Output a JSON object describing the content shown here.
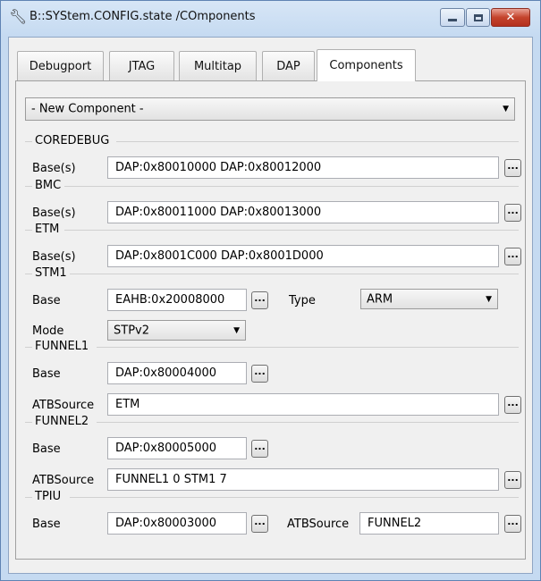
{
  "window": {
    "title": "B::SYStem.CONFIG.state /COmponents",
    "close_label": "✕",
    "app_icon": "wrench-icon"
  },
  "tabs": [
    {
      "label": "Debugport",
      "active": false
    },
    {
      "label": "JTAG",
      "active": false
    },
    {
      "label": "Multitap",
      "active": false
    },
    {
      "label": "DAP",
      "active": false
    },
    {
      "label": "Components",
      "active": true
    }
  ],
  "new_component": {
    "value": "- New Component -"
  },
  "browse_label": "...",
  "groups": {
    "coredebug": {
      "title": "COREDEBUG",
      "base_label": "Base(s)",
      "base_value": "DAP:0x80010000 DAP:0x80012000"
    },
    "bmc": {
      "title": "BMC",
      "base_label": "Base(s)",
      "base_value": "DAP:0x80011000 DAP:0x80013000"
    },
    "etm": {
      "title": "ETM",
      "base_label": "Base(s)",
      "base_value": "DAP:0x8001C000 DAP:0x8001D000"
    },
    "stm1": {
      "title": "STM1",
      "base_label": "Base",
      "base_value": "EAHB:0x20008000",
      "type_label": "Type",
      "type_value": "ARM",
      "mode_label": "Mode",
      "mode_value": "STPv2"
    },
    "funnel1": {
      "title": "FUNNEL1",
      "base_label": "Base",
      "base_value": "DAP:0x80004000",
      "atb_label": "ATBSource",
      "atb_value": "ETM"
    },
    "funnel2": {
      "title": "FUNNEL2",
      "base_label": "Base",
      "base_value": "DAP:0x80005000",
      "atb_label": "ATBSource",
      "atb_value": "FUNNEL1 0 STM1 7"
    },
    "tpiu": {
      "title": "TPIU",
      "base_label": "Base",
      "base_value": "DAP:0x80003000",
      "atb_label": "ATBSource",
      "atb_value": "FUNNEL2"
    }
  }
}
